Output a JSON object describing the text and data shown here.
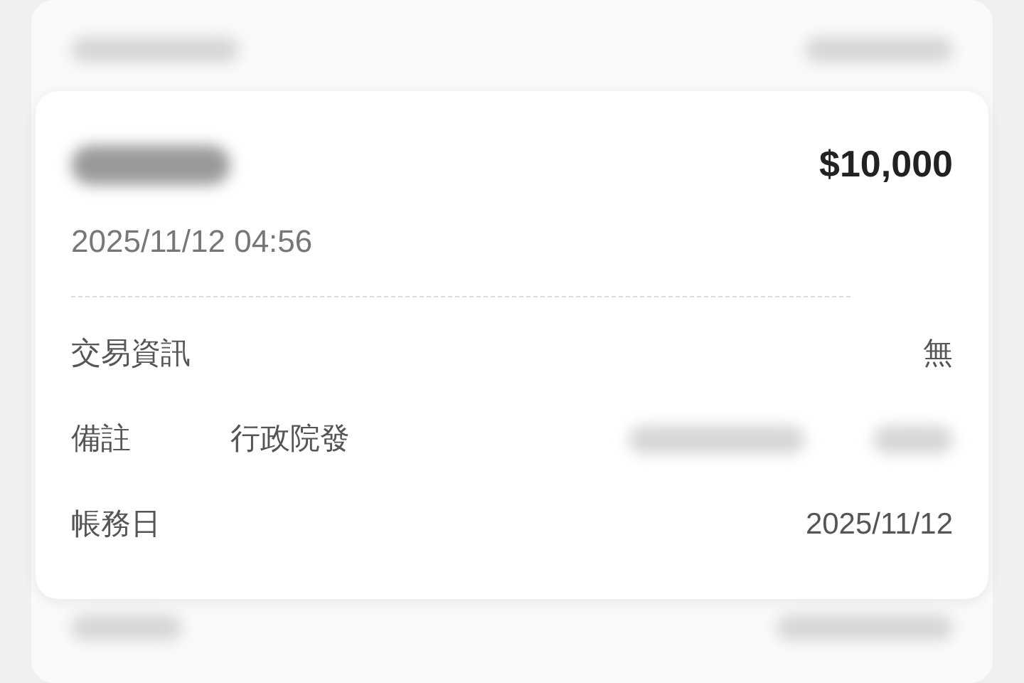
{
  "card": {
    "amount": "$10,000",
    "datetime": "2025/11/12 04:56",
    "rows": [
      {
        "kind": "plain",
        "label": "交易資訊",
        "value": "無"
      },
      {
        "kind": "note",
        "label": "備註",
        "value": "行政院發"
      },
      {
        "kind": "plain",
        "label": "帳務日",
        "value": "2025/11/12"
      }
    ]
  }
}
